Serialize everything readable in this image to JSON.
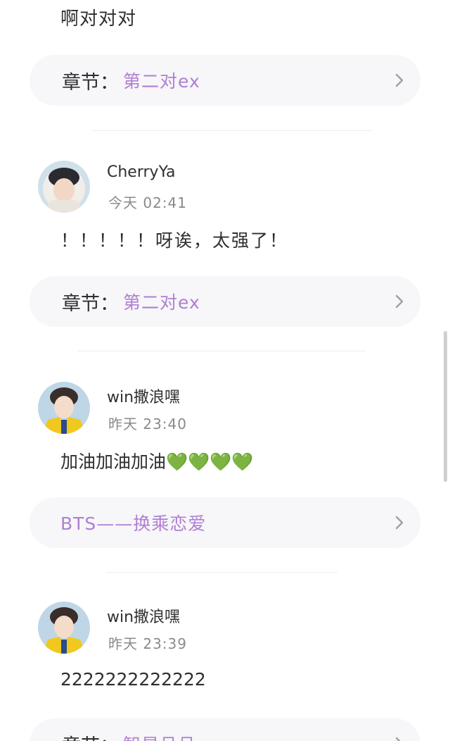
{
  "top_comment": "啊对对对",
  "chapter_label": "章节：",
  "comments": [
    {
      "username": "CherryYa",
      "time": "今天 02:41",
      "text": "！！！！！呀诶，太强了！",
      "chapter_value": "第二对ex"
    },
    {
      "username": "win撒浪嘿",
      "time": "昨天 23:40",
      "text": "加油加油加油💚💚💚💚",
      "link_text": "BTS——换乘恋爱"
    },
    {
      "username": "win撒浪嘿",
      "time": "昨天 23:39",
      "text": "2222222222222",
      "chapter_value": "智星旦旦"
    }
  ],
  "first_chapter_value": "第二对ex",
  "colors": {
    "accent": "#b07fd3",
    "card_bg": "#f7f6f8"
  },
  "icons": [
    "chevron-right-icon"
  ]
}
